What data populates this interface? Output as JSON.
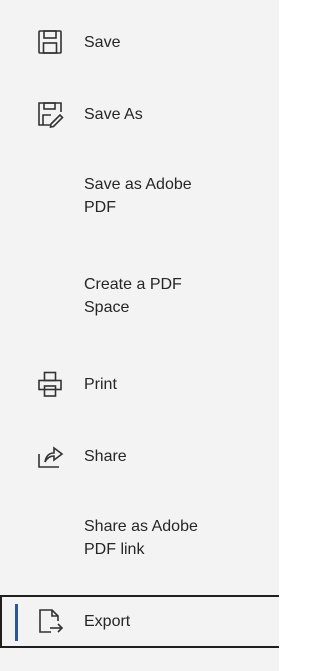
{
  "menu": {
    "items": [
      {
        "id": "save",
        "label": "Save",
        "icon": "save-icon"
      },
      {
        "id": "save-as",
        "label": "Save As",
        "icon": "save-as-icon"
      },
      {
        "id": "save-as-adobe-pdf",
        "label_line1": "Save as Adobe",
        "label_line2": "PDF"
      },
      {
        "id": "create-pdf-space",
        "label_line1": "Create a PDF",
        "label_line2": "Space"
      },
      {
        "id": "print",
        "label": "Print",
        "icon": "printer-icon"
      },
      {
        "id": "share",
        "label": "Share",
        "icon": "share-icon"
      },
      {
        "id": "share-adobe-link",
        "label_line1": "Share as Adobe",
        "label_line2": "PDF link"
      },
      {
        "id": "export",
        "label": "Export",
        "icon": "export-icon",
        "selected": true
      }
    ]
  },
  "colors": {
    "panel_bg": "#f3f3f3",
    "text": "#262626",
    "selected_accent": "#2b5797",
    "selected_border": "#1f1f1f"
  }
}
